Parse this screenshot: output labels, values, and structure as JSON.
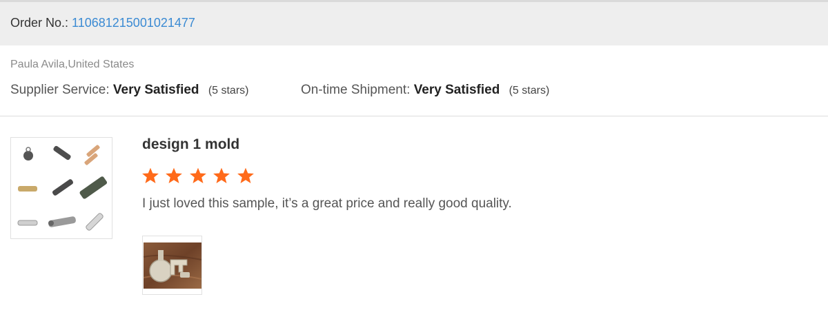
{
  "order": {
    "label": "Order No.:",
    "number": "110681215001021477"
  },
  "buyer": {
    "name_location": "Paula Avila,United States"
  },
  "ratings": [
    {
      "label": "Supplier Service:",
      "value": "Very Satisfied",
      "stars_text": "(5 stars)",
      "stars": 5
    },
    {
      "label": "On-time Shipment:",
      "value": "Very Satisfied",
      "stars_text": "(5 stars)",
      "stars": 5
    }
  ],
  "review": {
    "product_title": "design 1 mold",
    "rating": 5,
    "text": "I just loved this sample, it’s a great price and really good quality.",
    "star_color": "#ff6a1a"
  },
  "icons": {
    "product_thumbnail": "product-image",
    "review_photo": "photo-thumbnail",
    "star": "star-icon"
  },
  "colors": {
    "link": "#3a8ad3",
    "order_bar": "#eeeeee",
    "star": "#ff6a1a"
  }
}
